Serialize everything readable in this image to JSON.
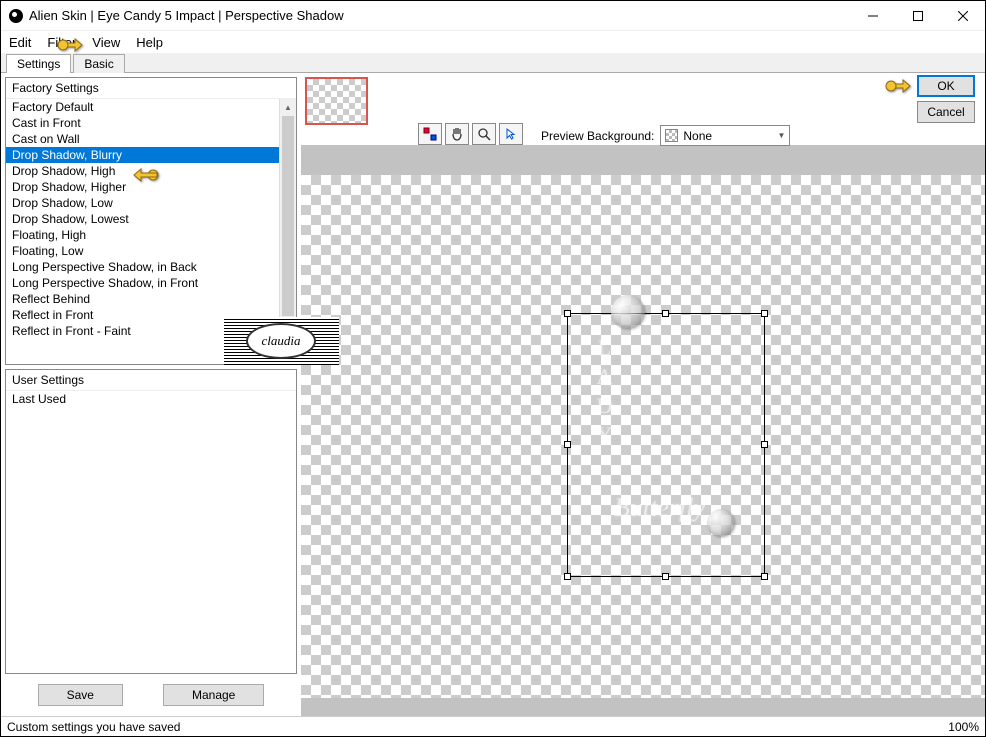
{
  "title": "Alien Skin | Eye Candy 5 Impact | Perspective Shadow",
  "menu": {
    "edit": "Edit",
    "filter": "Filter",
    "view": "View",
    "help": "Help"
  },
  "tabs": {
    "settings": "Settings",
    "basic": "Basic"
  },
  "factory": {
    "header": "Factory Settings",
    "items": [
      "Factory Default",
      "Cast in Front",
      "Cast on Wall",
      "Drop Shadow, Blurry",
      "Drop Shadow, High",
      "Drop Shadow, Higher",
      "Drop Shadow, Low",
      "Drop Shadow, Lowest",
      "Floating, High",
      "Floating, Low",
      "Long Perspective Shadow, in Back",
      "Long Perspective Shadow, in Front",
      "Reflect Behind",
      "Reflect in Front",
      "Reflect in Front - Faint"
    ],
    "selected_index": 3
  },
  "user": {
    "header": "User Settings",
    "items": [
      "Last Used"
    ]
  },
  "buttons": {
    "save": "Save",
    "manage": "Manage",
    "ok": "OK",
    "cancel": "Cancel"
  },
  "preview": {
    "bg_label": "Preview Background:",
    "bg_value": "None",
    "watermark_vertical": "LADY",
    "watermark_script": "Butterfly",
    "badge_text": "claudia"
  },
  "status": {
    "left": "Custom settings you have saved",
    "right": "100%"
  },
  "icons": {
    "tool1": "view-toggle-icon",
    "tool2": "hand-pan-icon",
    "tool3": "zoom-icon",
    "tool4": "pointer-icon"
  }
}
